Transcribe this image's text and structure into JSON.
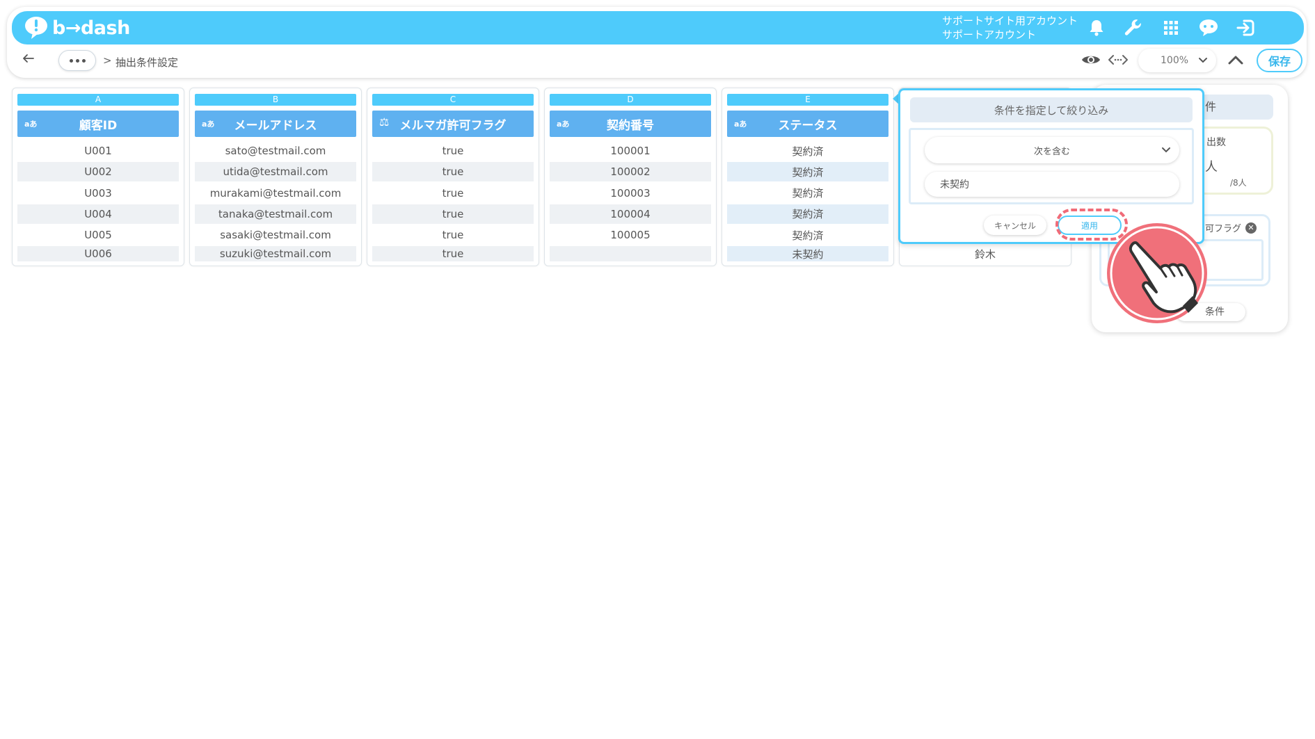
{
  "header": {
    "logo_text": "b→dash",
    "account_line1": "サポートサイト用アカウント",
    "account_line2": "サポートアカウント",
    "icons": [
      "bell-icon",
      "wrench-icon",
      "grid-icon",
      "chat-icon",
      "logout-icon"
    ],
    "brand_color": "#4ecbfb"
  },
  "toolbar": {
    "breadcrumb_separator": ">",
    "breadcrumb_current": "抽出条件設定",
    "zoom": "100%",
    "save_label": "保存"
  },
  "columns": [
    {
      "letter": "A",
      "name": "顧客ID",
      "type_label": "aあ",
      "cells": [
        "U001",
        "U002",
        "U003",
        "U004",
        "U005",
        "U006"
      ]
    },
    {
      "letter": "B",
      "name": "メールアドレス",
      "type_label": "aあ",
      "cells": [
        "sato@testmail.com",
        "utida@testmail.com",
        "murakami@testmail.com",
        "tanaka@testmail.com",
        "sasaki@testmail.com",
        "suzuki@testmail.com"
      ]
    },
    {
      "letter": "C",
      "name": "メルマガ許可フラグ",
      "type_label": "⚖",
      "cells": [
        "true",
        "true",
        "true",
        "true",
        "true",
        "true"
      ]
    },
    {
      "letter": "D",
      "name": "契約番号",
      "type_label": "aあ",
      "cells": [
        "100001",
        "100002",
        "100003",
        "100004",
        "100005",
        ""
      ]
    },
    {
      "letter": "E",
      "name": "ステータス",
      "type_label": "aあ",
      "cells": [
        "契約済",
        "契約済",
        "契約済",
        "契約済",
        "契約済",
        "未契約"
      ]
    }
  ],
  "column_f_visible_cell": "鈴木",
  "side_panel": {
    "title_fragment": "件",
    "count_label_fragment": "出数",
    "count_unit": "人",
    "count_total": "/8人",
    "condition_chip_fragment": "可フラグ",
    "add_condition_fragment": "条件"
  },
  "filter_popup": {
    "title": "条件を指定して絞り込み",
    "operator": "次を含む",
    "value": "未契約",
    "cancel_label": "キャンセル",
    "apply_label": "適用",
    "highlight_color": "#f06b78"
  }
}
